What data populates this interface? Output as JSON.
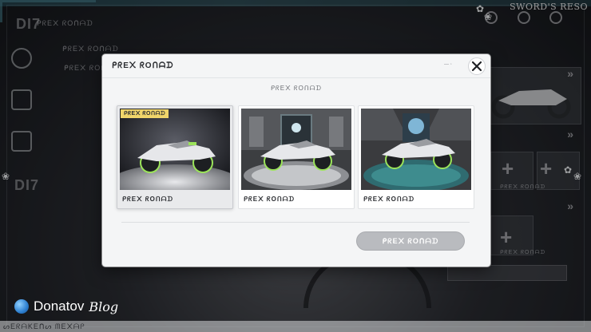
{
  "background": {
    "top_labels": [
      "DI7",
      "ᑭᖇE᙭ ᖇOᑎᗩᗪ",
      "ᑭᖇE᙭ ᖇOᑎᗩᗪ",
      "ᑭᖇE᙭ ᖇOᑎᗩᗪ"
    ],
    "side_label": "DI7",
    "card_labels": [
      "ᑭᖇE᙭ ᖇOᑎᗩᗪ",
      "ᑭᖇE᙭ ᖇOᑎᗩᗪ"
    ],
    "logo": "SWORD'S RESO",
    "bottom_strip": "ᔕEᖇᗩKEᑎᔕ ᗰE᙭ᗩᑭ"
  },
  "watermark": {
    "brand": "Donatov",
    "suffix": "Blog"
  },
  "dialog": {
    "title": "ᑭᖇE᙭ ᖇOᑎᗩᗪ",
    "hint": "— ◦",
    "subtitle": "ᑭᖇE᙭ ᖇOᑎᗩᗪ",
    "options": [
      {
        "label": "ᑭᖇE᙭ ᖇOᑎᗩᗪ",
        "badge": "ᑭᖇE᙭ ᖇOᑎᗩᗪ",
        "selected": true,
        "scene": "dark"
      },
      {
        "label": "ᑭᖇE᙭ ᖇOᑎᗩᗪ",
        "selected": false,
        "scene": "hall"
      },
      {
        "label": "ᑭᖇE᙭ ᖇOᑎᗩᗪ",
        "selected": false,
        "scene": "fountain"
      }
    ],
    "confirm_label": "ᑭᖇE᙭ ᖇOᑎᗩᗪ",
    "close_icon": "close-icon"
  },
  "colors": {
    "badge": "#f0d56a",
    "accent_green": "#9be35a",
    "confirm_disabled": "#b9bbbf"
  }
}
